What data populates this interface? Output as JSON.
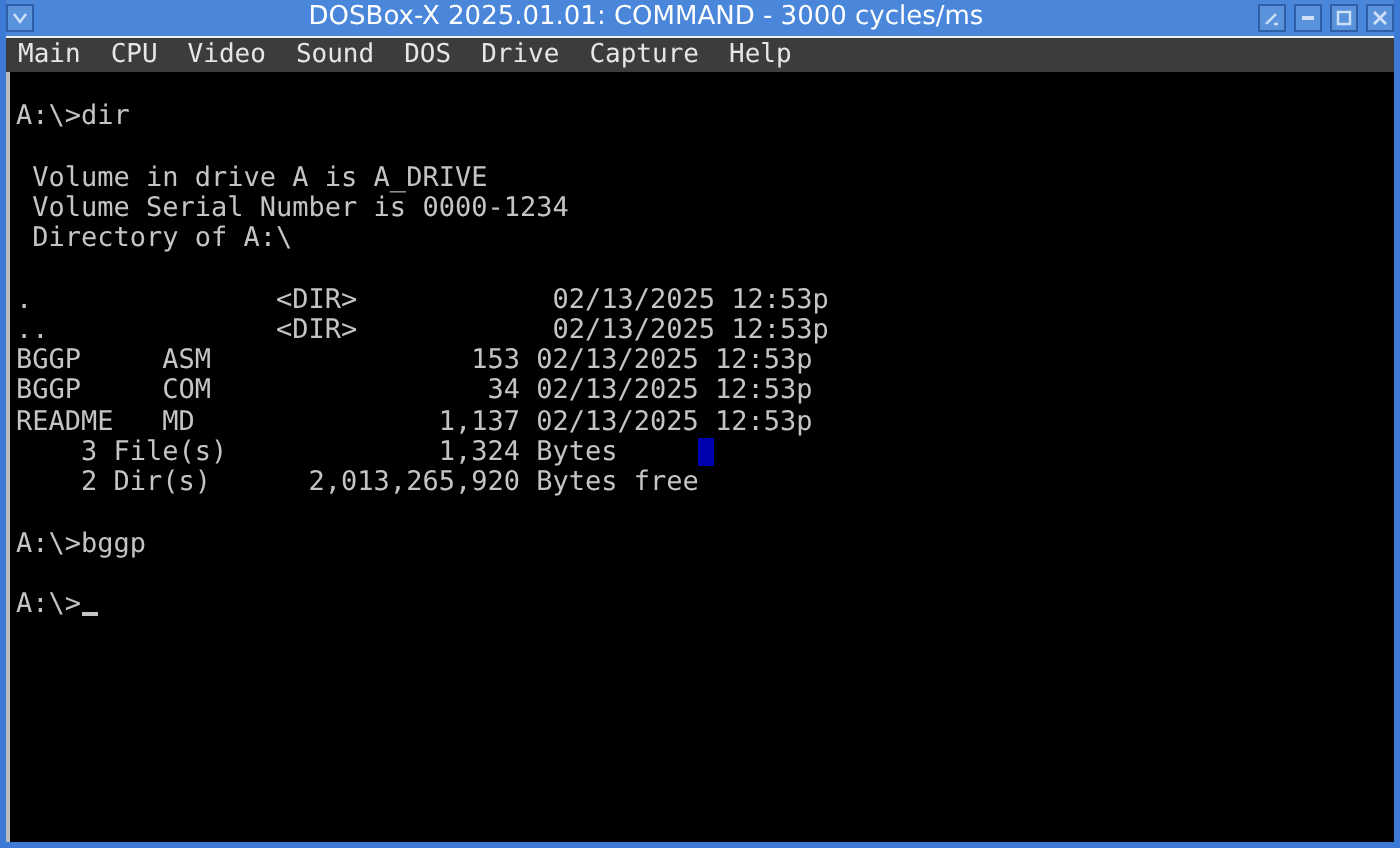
{
  "window": {
    "title": "DOSBox-X 2025.01.01: COMMAND - 3000 cycles/ms"
  },
  "menu": [
    "Main",
    "CPU",
    "Video",
    "Sound",
    "DOS",
    "Drive",
    "Capture",
    "Help"
  ],
  "terminal": {
    "cursor": true,
    "blocks": [
      [
        "A:\\>dir"
      ],
      [
        " Volume in drive A is A_DRIVE",
        " Volume Serial Number is 0000-1234",
        " Directory of A:\\"
      ],
      [
        ".               <DIR>            02/13/2025 12:53p",
        "..              <DIR>            02/13/2025 12:53p",
        "BGGP     ASM                153 02/13/2025 12:53p",
        "BGGP     COM                 34 02/13/2025 12:53p",
        "README   MD               1,137 02/13/2025 12:53p",
        {
          "text": "    3 File(s)             1,324 Bytes",
          "marker": true
        },
        "    2 Dir(s)      2,013,265,920 Bytes free"
      ],
      [
        "A:\\>bggp"
      ],
      [
        "A:\\>"
      ]
    ]
  }
}
